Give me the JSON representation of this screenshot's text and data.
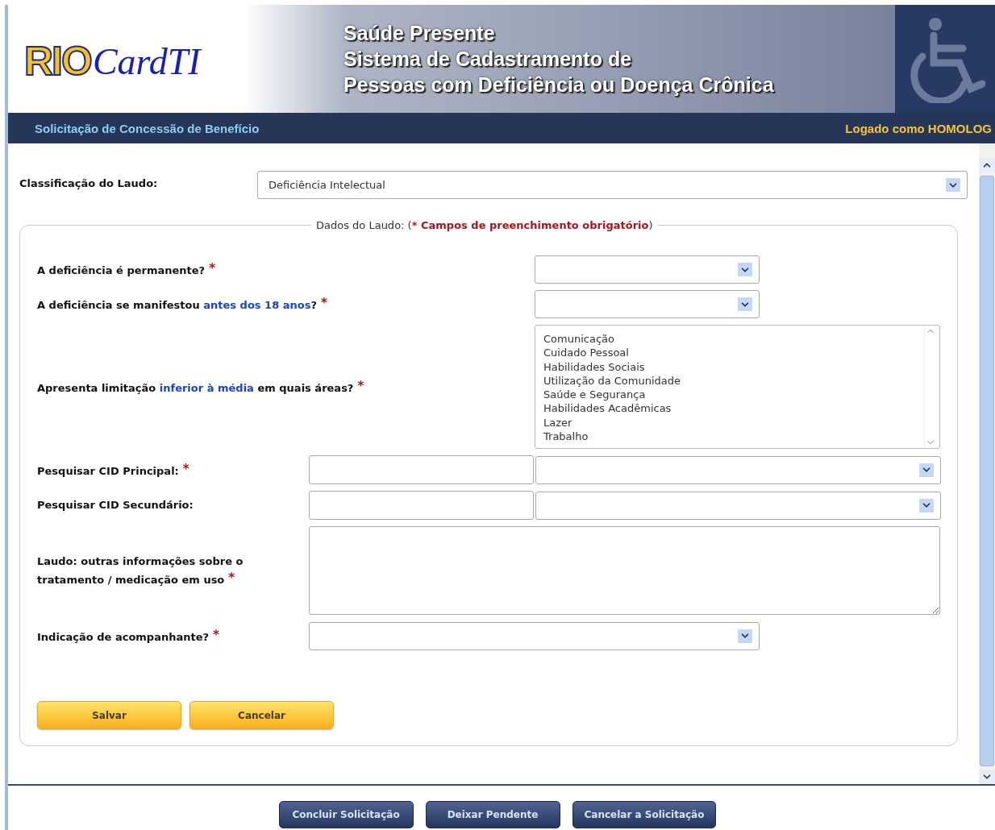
{
  "header": {
    "logo": {
      "bold": "RIO",
      "script": "CardTI"
    },
    "title_lines": [
      "Saúde Presente",
      "Sistema de Cadastramento de",
      "Pessoas com Deficiência ou Doença Crônica"
    ]
  },
  "nav": {
    "page_title": "Solicitação de Concessão de Benefício",
    "user": "Logado como HOMOLOG"
  },
  "classification": {
    "label": "Classificação do Laudo:",
    "value": "Deficiência Intelectual"
  },
  "fieldset": {
    "legend": [
      {
        "text": "Dados do Laudo: ("
      },
      {
        "text": "*",
        "color": "#c0141c",
        "bold": true
      },
      {
        "text": " Campos de preenchimento obrigatório",
        "color": "#a8141c",
        "bold": true
      },
      {
        "text": ")"
      }
    ]
  },
  "fields": [
    {
      "kind": "select",
      "label": [
        {
          "text": "A deficiência é permanente?"
        }
      ],
      "mark": "*"
    },
    {
      "kind": "select",
      "label": [
        {
          "text": "A deficiência se manifestou "
        },
        {
          "text": "antes dos 18 anos",
          "color": "#1b3fd0"
        },
        {
          "text": "?"
        }
      ],
      "mark": "*"
    },
    {
      "kind": "listbox",
      "label": [
        {
          "text": "Apresenta limitação "
        },
        {
          "text": "inferior à média",
          "color": "#1b3fd0"
        },
        {
          "text": " em quais áreas?"
        }
      ],
      "mark": "*",
      "options": [
        {
          "text": "Comunicação",
          "selected": false
        },
        {
          "text": "Cuidado Pessoal",
          "selected": false
        },
        {
          "text": "Habilidades Sociais",
          "selected": false
        },
        {
          "text": "Utilização da Comunidade",
          "selected": false
        },
        {
          "text": "Saúde e Segurança",
          "selected": false
        },
        {
          "text": "Habilidades Acadêmicas",
          "selected": false
        },
        {
          "text": "Lazer",
          "selected": false
        },
        {
          "text": "Trabalho",
          "selected": false
        }
      ]
    },
    {
      "kind": "search",
      "label": [
        {
          "text": "Pesquisar CID Principal:"
        }
      ],
      "mark": "*"
    },
    {
      "kind": "search",
      "label": [
        {
          "text": "Pesquisar CID Secundário:"
        }
      ]
    },
    {
      "kind": "textarea",
      "label": [
        {
          "text": "Laudo: outras informações sobre o tratamento / medicação em uso"
        }
      ],
      "mark": "*"
    },
    {
      "kind": "select_wide",
      "label": [
        {
          "text": "Indicação de acompanhante?"
        }
      ],
      "mark": "*"
    }
  ],
  "form_buttons": [
    "Salvar",
    "Cancelar"
  ],
  "footer_buttons": [
    "Concluir Solicitação",
    "Deixar Pendente",
    "Cancelar a Solicitação"
  ]
}
